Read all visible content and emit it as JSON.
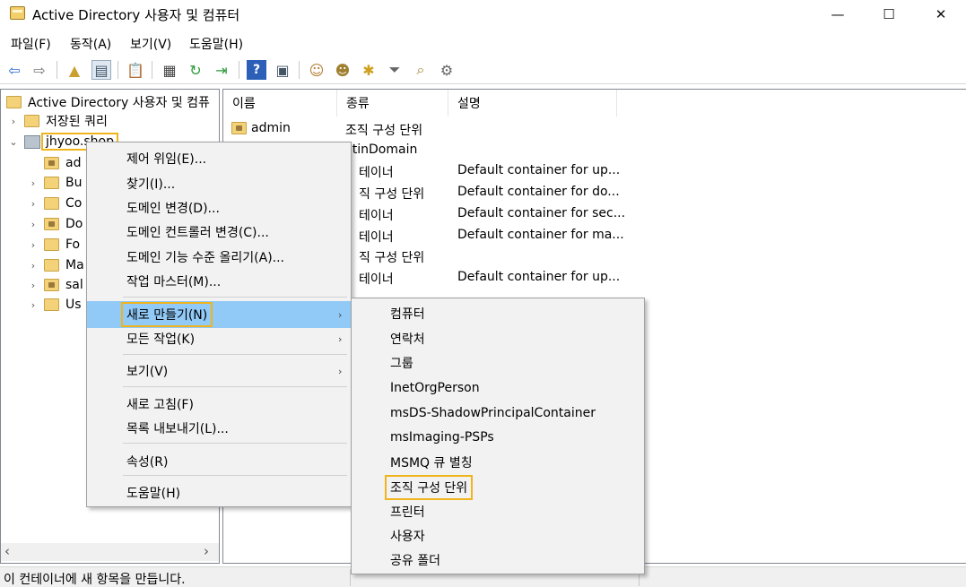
{
  "window": {
    "title": "Active Directory 사용자 및 컴퓨터",
    "minimize": "—",
    "maximize": "☐",
    "close": "✕"
  },
  "menubar": [
    "파일(F)",
    "동작(A)",
    "보기(V)",
    "도움말(H)"
  ],
  "toolbar": [
    {
      "name": "back-icon",
      "glyph": "⇦"
    },
    {
      "name": "forward-icon",
      "glyph": "⇨"
    },
    {
      "name": "up-folder-icon",
      "glyph": "▲"
    },
    {
      "name": "show-tree-icon",
      "glyph": "▤"
    },
    {
      "name": "clipboard-icon",
      "glyph": "📋"
    },
    {
      "name": "properties-icon",
      "glyph": "▦"
    },
    {
      "name": "refresh-icon",
      "glyph": "↻"
    },
    {
      "name": "export-list-icon",
      "glyph": "⇥"
    },
    {
      "name": "help-icon",
      "glyph": "?"
    },
    {
      "name": "console-icon",
      "glyph": "▣"
    },
    {
      "name": "new-user-icon",
      "glyph": "☺"
    },
    {
      "name": "new-group-icon",
      "glyph": "☻"
    },
    {
      "name": "new-ou-icon",
      "glyph": "✱"
    },
    {
      "name": "filter-icon",
      "glyph": "⏷"
    },
    {
      "name": "find-icon",
      "glyph": "⌕"
    },
    {
      "name": "add-to-group-icon",
      "glyph": "⚙"
    }
  ],
  "tree": {
    "root": "Active Directory 사용자 및 컴퓨",
    "saved_queries": "저장된 쿼리",
    "domain": "jhyoo.shop",
    "children": [
      "ad",
      "Bu",
      "Co",
      "Do",
      "Fo",
      "Ma",
      "sal",
      "Us"
    ]
  },
  "list": {
    "columns": [
      "이름",
      "종류",
      "설명"
    ],
    "rows": [
      {
        "name": "admin",
        "type": "조직 구성 단위",
        "desc": ""
      },
      {
        "name": "",
        "type": "iltinDomain",
        "desc": ""
      },
      {
        "name": "",
        "type": "테이너",
        "desc": "Default container for up..."
      },
      {
        "name": "",
        "type": "직 구성 단위",
        "desc": "Default container for do..."
      },
      {
        "name": "",
        "type": "테이너",
        "desc": "Default container for sec..."
      },
      {
        "name": "",
        "type": "테이너",
        "desc": "Default container for ma..."
      },
      {
        "name": "",
        "type": "직 구성 단위",
        "desc": ""
      },
      {
        "name": "",
        "type": "테이너",
        "desc": "Default container for up..."
      }
    ]
  },
  "context_menu": {
    "items": [
      "제어 위임(E)...",
      "찾기(I)...",
      "도메인 변경(D)...",
      "도메인 컨트롤러 변경(C)...",
      "도메인 기능 수준 올리기(A)...",
      "작업 마스터(M)...",
      "새로 만들기(N)",
      "모든 작업(K)",
      "보기(V)",
      "새로 고침(F)",
      "목록 내보내기(L)...",
      "속성(R)",
      "도움말(H)"
    ],
    "arrow": "›"
  },
  "submenu": {
    "items": [
      "컴퓨터",
      "연락처",
      "그룹",
      "InetOrgPerson",
      "msDS-ShadowPrincipalContainer",
      "msImaging-PSPs",
      "MSMQ 큐 별칭",
      "조직 구성 단위",
      "프린터",
      "사용자",
      "공유 폴더"
    ]
  },
  "scrollbar": {
    "left": "‹",
    "right": "›"
  },
  "status": "이 컨테이너에 새 항목을 만듭니다.",
  "colors": {
    "highlight_box": "#f0b41c",
    "menu_selected": "#91c9f7"
  }
}
